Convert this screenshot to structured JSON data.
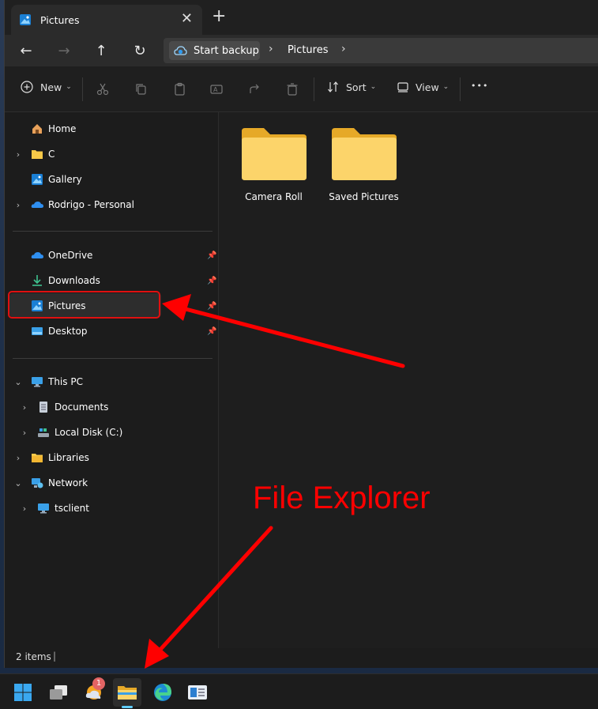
{
  "window": {
    "tab_title": "Pictures",
    "tab_close": "✕",
    "new_tab": "+"
  },
  "address_bar": {
    "back": "←",
    "forward": "→",
    "up": "↑",
    "refresh": "↻",
    "backup_label": "Start backup",
    "crumb_separator": "›",
    "current_folder": "Pictures"
  },
  "toolbar": {
    "new_label": "New",
    "sort_label": "Sort",
    "view_label": "View",
    "more_label": "•••",
    "caret": "⌄"
  },
  "sidebar": {
    "quick": [
      {
        "label": "Home",
        "icon": "home-icon",
        "expandable": false
      },
      {
        "label": "C",
        "icon": "folder-icon",
        "expandable": true
      },
      {
        "label": "Gallery",
        "icon": "gallery-icon",
        "expandable": false
      },
      {
        "label": "Rodrigo - Personal",
        "icon": "onedrive-icon",
        "expandable": true
      }
    ],
    "pinned": [
      {
        "label": "OneDrive",
        "icon": "onedrive-icon",
        "pinned": true
      },
      {
        "label": "Downloads",
        "icon": "download-icon",
        "pinned": true
      },
      {
        "label": "Pictures",
        "icon": "pictures-icon",
        "pinned": true,
        "selected": true
      },
      {
        "label": "Desktop",
        "icon": "desktop-icon",
        "pinned": true
      }
    ],
    "tree": [
      {
        "label": "This PC",
        "icon": "pc-icon",
        "expanded": true
      },
      {
        "label": "Documents",
        "icon": "documents-icon",
        "expandable": true
      },
      {
        "label": "Local Disk (C:)",
        "icon": "disk-icon",
        "expandable": true
      },
      {
        "label": "Libraries",
        "icon": "libraries-icon",
        "expandable": true
      },
      {
        "label": "Network",
        "icon": "network-icon",
        "expanded": true
      },
      {
        "label": "tsclient",
        "icon": "pc-icon",
        "expandable": true
      }
    ]
  },
  "content": {
    "items": [
      {
        "name": "Camera Roll",
        "icon": "folder-icon"
      },
      {
        "name": "Saved Pictures",
        "icon": "folder-icon"
      }
    ]
  },
  "status": {
    "item_count": "2 items",
    "separator": "|"
  },
  "taskbar": {
    "badge_count": "1",
    "apps": [
      "start-icon",
      "task-view-icon",
      "weather-icon",
      "file-explorer-icon",
      "edge-icon",
      "news-icon"
    ],
    "accent": "#60cdff"
  },
  "annotations": {
    "label": "File Explorer",
    "color": "#ff0000"
  },
  "colors": {
    "folder_yellow": "#f7c948",
    "window_bg": "#1e1e1e",
    "highlight": "#e01010"
  }
}
